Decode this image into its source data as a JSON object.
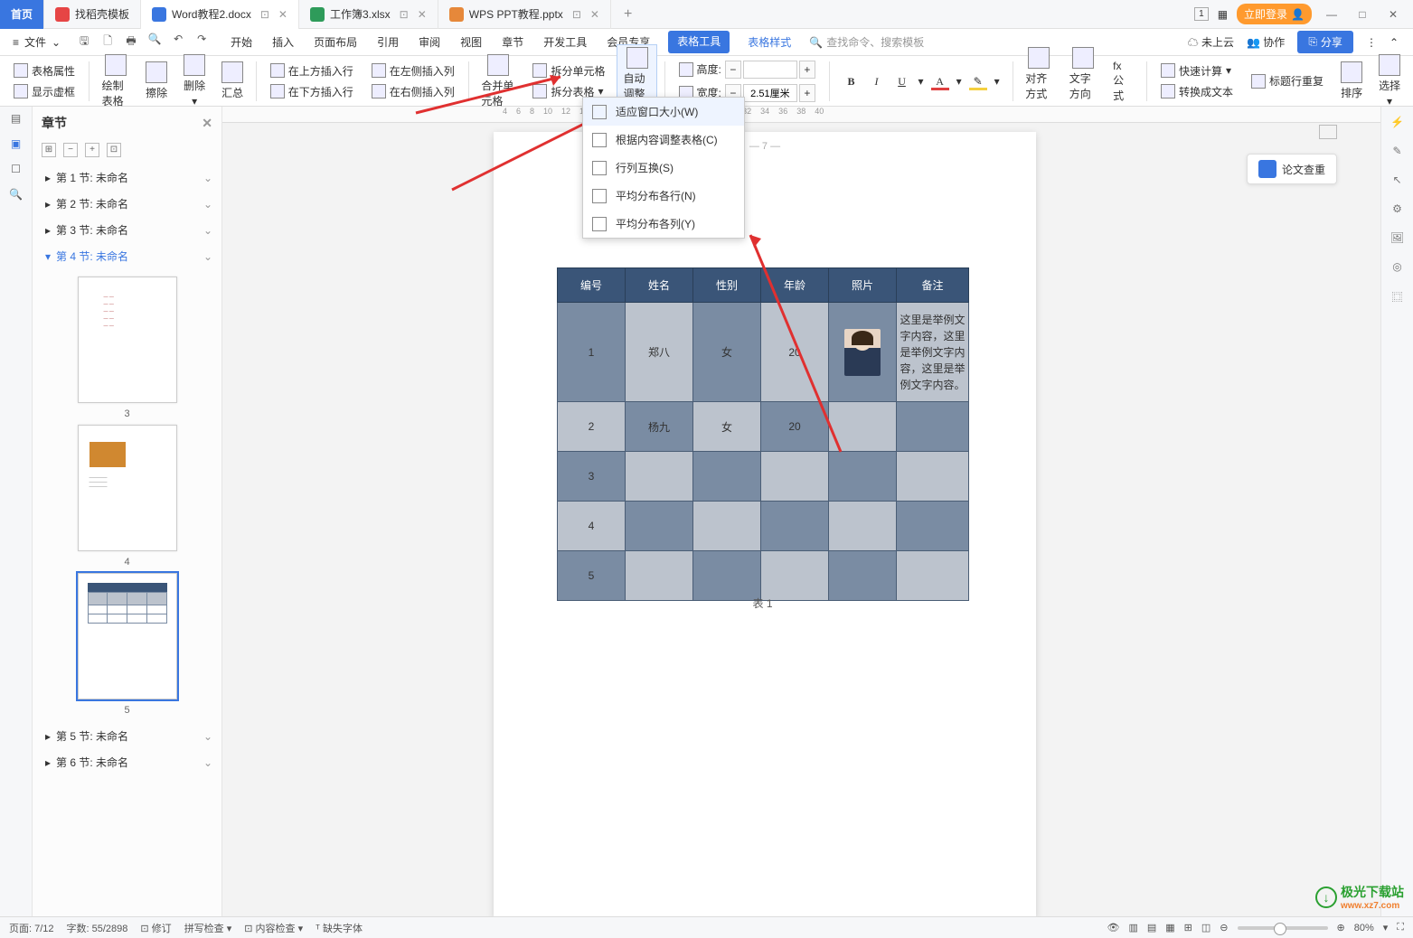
{
  "tabs": {
    "home": "首页",
    "t1": "找稻壳模板",
    "t2": "Word教程2.docx",
    "t3": "工作簿3.xlsx",
    "t4": "WPS PPT教程.pptx"
  },
  "win": {
    "login": "立即登录",
    "indicator": "1"
  },
  "filemenu": "文件",
  "menutabs": {
    "start": "开始",
    "insert": "插入",
    "layout": "页面布局",
    "ref": "引用",
    "review": "审阅",
    "view": "视图",
    "chapter": "章节",
    "dev": "开发工具",
    "member": "会员专享",
    "tabletool": "表格工具",
    "tablestyle": "表格样式"
  },
  "search_placeholder": "查找命令、搜索模板",
  "rightmenu": {
    "cloud": "未上云",
    "coop": "协作",
    "share": "分享"
  },
  "ribbon": {
    "props": "表格属性",
    "vframe": "显示虚框",
    "draw": "绘制表格",
    "erase": "擦除",
    "del": "删除",
    "sum": "汇总",
    "ins_above": "在上方插入行",
    "ins_below": "在下方插入行",
    "ins_left": "在左侧插入列",
    "ins_right": "在右侧插入列",
    "merge": "合并单元格",
    "split": "拆分单元格",
    "split_tbl": "拆分表格",
    "auto": "自动调整",
    "height": "高度:",
    "width": "宽度:",
    "w_val": "2.51厘米",
    "align": "对齐方式",
    "textdir": "文字方向",
    "fx": "fx 公式",
    "quick": "快速计算",
    "repeat": "标题行重复",
    "totext": "转换成文本",
    "sort": "排序",
    "select": "选择"
  },
  "dropdown": {
    "fit": "适应窗口大小(W)",
    "content": "根据内容调整表格(C)",
    "swap": "行列互换(S)",
    "rows": "平均分布各行(N)",
    "cols": "平均分布各列(Y)"
  },
  "nav": {
    "title": "章节",
    "s1": "第 1 节: 未命名",
    "s2": "第 2 节: 未命名",
    "s3": "第 3 节: 未命名",
    "s4": "第 4 节: 未命名",
    "s5": "第 5 节: 未命名",
    "s6": "第 6 节: 未命名",
    "p3": "3",
    "p4": "4",
    "p5": "5"
  },
  "floatbtn": "论文查重",
  "pagenum": "— 7 —",
  "table": {
    "h1": "编号",
    "h2": "姓名",
    "h3": "性别",
    "h4": "年龄",
    "h5": "照片",
    "h6": "备注",
    "r1": {
      "c1": "1",
      "c2": "郑八",
      "c3": "女",
      "c4": "20",
      "c6": "这里是举例文字内容，这里是举例文字内容，这里是举例文字内容。"
    },
    "r2": {
      "c1": "2",
      "c2": "杨九",
      "c3": "女",
      "c4": "20"
    },
    "r3": {
      "c1": "3"
    },
    "r4": {
      "c1": "4"
    },
    "r5": {
      "c1": "5"
    },
    "caption": "表 1"
  },
  "status": {
    "page": "页面: 7/12",
    "words": "字数: 55/2898",
    "rev": "修订",
    "spell": "拼写检查",
    "content": "内容检查",
    "font": "缺失字体",
    "zoom": "80%"
  },
  "watermark": {
    "name": "极光下载站",
    "url": "www.xz7.com"
  }
}
